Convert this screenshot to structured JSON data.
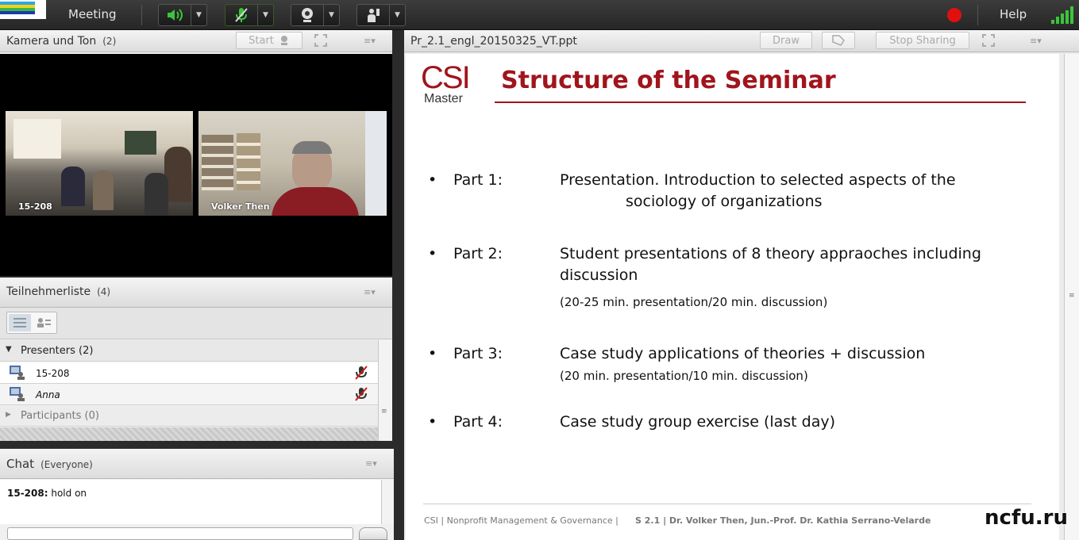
{
  "app": {
    "menu_meeting": "Meeting",
    "help": "Help"
  },
  "camera_pod": {
    "title": "Kamera und Ton",
    "count": "(2)",
    "start_label": "Start",
    "tiles": [
      {
        "label": "15-208"
      },
      {
        "label": "Volker Then"
      }
    ]
  },
  "attendees_pod": {
    "title": "Teilnehmerliste",
    "count": "(4)",
    "presenters_label": "Presenters (2)",
    "presenters": [
      {
        "name": "15-208"
      },
      {
        "name": "Anna"
      }
    ],
    "participants_label": "Participants (0)"
  },
  "chat_pod": {
    "title": "Chat",
    "audience": "(Everyone)",
    "messages": [
      {
        "sender": "15-208:",
        "text": "hold on"
      }
    ]
  },
  "share_pod": {
    "filename": "Pr_2.1_engl_20150325_VT.ppt",
    "draw_label": "Draw",
    "stop_label": "Stop Sharing"
  },
  "slide": {
    "logo_csi": "CSI",
    "logo_master": "Master",
    "title": "Structure of the Seminar",
    "parts": [
      {
        "label": "Part 1:",
        "line1": "Presentation. Introduction to selected aspects of the",
        "line2": "sociology of organizations",
        "note": ""
      },
      {
        "label": "Part 2:",
        "line1": "Student presentations of 8 theory appraoches including",
        "line2": "discussion",
        "note": "(20-25 min. presentation/20 min. discussion)"
      },
      {
        "label": "Part 3:",
        "line1": "Case study applications of theories + discussion",
        "line2": "",
        "note": "(20 min. presentation/10 min. discussion)"
      },
      {
        "label": "Part 4:",
        "line1": "Case study group exercise (last day)",
        "line2": "",
        "note": ""
      }
    ],
    "footer_left": "CSI | Nonprofit Management & Governance |",
    "footer_right": "S 2.1 | Dr. Volker Then, Jun.-Prof. Dr. Kathia Serrano-Velarde"
  },
  "watermark": "ncfu.ru",
  "colors": {
    "accent_red": "#a0151c",
    "mic_green": "#3cc43c",
    "record_red": "#e01010"
  }
}
